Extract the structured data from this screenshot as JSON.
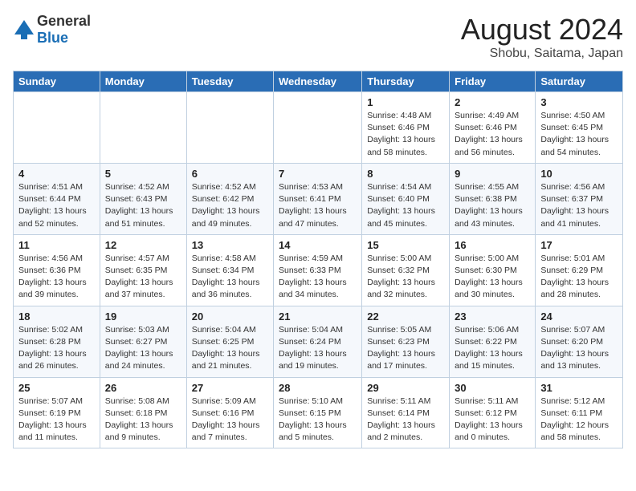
{
  "header": {
    "logo_general": "General",
    "logo_blue": "Blue",
    "month_year": "August 2024",
    "location": "Shobu, Saitama, Japan"
  },
  "weekdays": [
    "Sunday",
    "Monday",
    "Tuesday",
    "Wednesday",
    "Thursday",
    "Friday",
    "Saturday"
  ],
  "weeks": [
    [
      {
        "day": "",
        "info": ""
      },
      {
        "day": "",
        "info": ""
      },
      {
        "day": "",
        "info": ""
      },
      {
        "day": "",
        "info": ""
      },
      {
        "day": "1",
        "info": "Sunrise: 4:48 AM\nSunset: 6:46 PM\nDaylight: 13 hours\nand 58 minutes."
      },
      {
        "day": "2",
        "info": "Sunrise: 4:49 AM\nSunset: 6:46 PM\nDaylight: 13 hours\nand 56 minutes."
      },
      {
        "day": "3",
        "info": "Sunrise: 4:50 AM\nSunset: 6:45 PM\nDaylight: 13 hours\nand 54 minutes."
      }
    ],
    [
      {
        "day": "4",
        "info": "Sunrise: 4:51 AM\nSunset: 6:44 PM\nDaylight: 13 hours\nand 52 minutes."
      },
      {
        "day": "5",
        "info": "Sunrise: 4:52 AM\nSunset: 6:43 PM\nDaylight: 13 hours\nand 51 minutes."
      },
      {
        "day": "6",
        "info": "Sunrise: 4:52 AM\nSunset: 6:42 PM\nDaylight: 13 hours\nand 49 minutes."
      },
      {
        "day": "7",
        "info": "Sunrise: 4:53 AM\nSunset: 6:41 PM\nDaylight: 13 hours\nand 47 minutes."
      },
      {
        "day": "8",
        "info": "Sunrise: 4:54 AM\nSunset: 6:40 PM\nDaylight: 13 hours\nand 45 minutes."
      },
      {
        "day": "9",
        "info": "Sunrise: 4:55 AM\nSunset: 6:38 PM\nDaylight: 13 hours\nand 43 minutes."
      },
      {
        "day": "10",
        "info": "Sunrise: 4:56 AM\nSunset: 6:37 PM\nDaylight: 13 hours\nand 41 minutes."
      }
    ],
    [
      {
        "day": "11",
        "info": "Sunrise: 4:56 AM\nSunset: 6:36 PM\nDaylight: 13 hours\nand 39 minutes."
      },
      {
        "day": "12",
        "info": "Sunrise: 4:57 AM\nSunset: 6:35 PM\nDaylight: 13 hours\nand 37 minutes."
      },
      {
        "day": "13",
        "info": "Sunrise: 4:58 AM\nSunset: 6:34 PM\nDaylight: 13 hours\nand 36 minutes."
      },
      {
        "day": "14",
        "info": "Sunrise: 4:59 AM\nSunset: 6:33 PM\nDaylight: 13 hours\nand 34 minutes."
      },
      {
        "day": "15",
        "info": "Sunrise: 5:00 AM\nSunset: 6:32 PM\nDaylight: 13 hours\nand 32 minutes."
      },
      {
        "day": "16",
        "info": "Sunrise: 5:00 AM\nSunset: 6:30 PM\nDaylight: 13 hours\nand 30 minutes."
      },
      {
        "day": "17",
        "info": "Sunrise: 5:01 AM\nSunset: 6:29 PM\nDaylight: 13 hours\nand 28 minutes."
      }
    ],
    [
      {
        "day": "18",
        "info": "Sunrise: 5:02 AM\nSunset: 6:28 PM\nDaylight: 13 hours\nand 26 minutes."
      },
      {
        "day": "19",
        "info": "Sunrise: 5:03 AM\nSunset: 6:27 PM\nDaylight: 13 hours\nand 24 minutes."
      },
      {
        "day": "20",
        "info": "Sunrise: 5:04 AM\nSunset: 6:25 PM\nDaylight: 13 hours\nand 21 minutes."
      },
      {
        "day": "21",
        "info": "Sunrise: 5:04 AM\nSunset: 6:24 PM\nDaylight: 13 hours\nand 19 minutes."
      },
      {
        "day": "22",
        "info": "Sunrise: 5:05 AM\nSunset: 6:23 PM\nDaylight: 13 hours\nand 17 minutes."
      },
      {
        "day": "23",
        "info": "Sunrise: 5:06 AM\nSunset: 6:22 PM\nDaylight: 13 hours\nand 15 minutes."
      },
      {
        "day": "24",
        "info": "Sunrise: 5:07 AM\nSunset: 6:20 PM\nDaylight: 13 hours\nand 13 minutes."
      }
    ],
    [
      {
        "day": "25",
        "info": "Sunrise: 5:07 AM\nSunset: 6:19 PM\nDaylight: 13 hours\nand 11 minutes."
      },
      {
        "day": "26",
        "info": "Sunrise: 5:08 AM\nSunset: 6:18 PM\nDaylight: 13 hours\nand 9 minutes."
      },
      {
        "day": "27",
        "info": "Sunrise: 5:09 AM\nSunset: 6:16 PM\nDaylight: 13 hours\nand 7 minutes."
      },
      {
        "day": "28",
        "info": "Sunrise: 5:10 AM\nSunset: 6:15 PM\nDaylight: 13 hours\nand 5 minutes."
      },
      {
        "day": "29",
        "info": "Sunrise: 5:11 AM\nSunset: 6:14 PM\nDaylight: 13 hours\nand 2 minutes."
      },
      {
        "day": "30",
        "info": "Sunrise: 5:11 AM\nSunset: 6:12 PM\nDaylight: 13 hours\nand 0 minutes."
      },
      {
        "day": "31",
        "info": "Sunrise: 5:12 AM\nSunset: 6:11 PM\nDaylight: 12 hours\nand 58 minutes."
      }
    ]
  ]
}
